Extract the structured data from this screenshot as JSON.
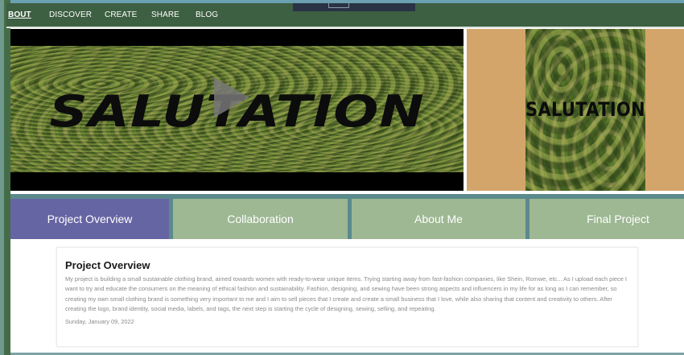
{
  "nav": {
    "items": [
      {
        "label": "BOUT",
        "active": true
      },
      {
        "label": "DISCOVER",
        "active": false
      },
      {
        "label": "CREATE",
        "active": false
      },
      {
        "label": "SHARE",
        "active": false
      },
      {
        "label": "BLOG",
        "active": false
      }
    ]
  },
  "media": {
    "video_title": "SALUTATION",
    "cover_title": "SALUTATION"
  },
  "tabs": [
    {
      "label": "Project Overview",
      "active": true
    },
    {
      "label": "Collaboration",
      "active": false
    },
    {
      "label": "About Me",
      "active": false
    },
    {
      "label": "Final Project",
      "active": false
    }
  ],
  "card": {
    "title": "Project Overview",
    "body": "My project is building a small sustainable clothing brand, aimed towards women with ready-to-wear unique items. Trying starting away from fast-fashion companies, like Shein, Romwe, etc... As I upload each piece I want to try and educate the consumers on the meaning of ethical fashion and sustainability. Fashion, designing, and sewing have been strong aspects and influencers in my life for as long as I can remember, so creating my own small clothing brand is something very important to me and I aim to sell pieces that I create and create a small business that I love, while also sharing that content and creativity to others. After creating the logo, brand identity, social media, labels, and tags, the next step is starting the cycle of designing, sewing, selling, and repeating.",
    "date": "Sunday, January 09, 2022"
  },
  "colors": {
    "nav_bg": "#3d5f42",
    "tab_active": "#6565a3",
    "tab_inactive": "#9db893",
    "side_panel": "#d4a56b"
  }
}
